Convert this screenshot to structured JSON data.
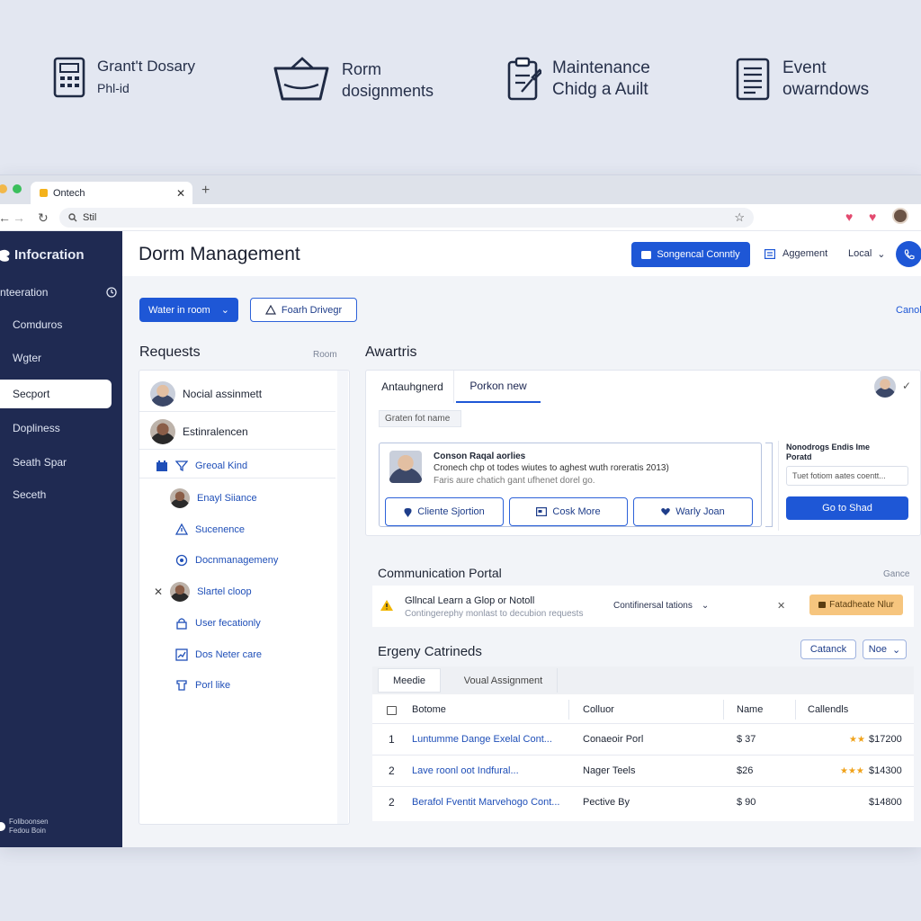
{
  "features": [
    {
      "icon": "calculator-icon",
      "line1": "Grant't Dosary",
      "line2": "Phl-id"
    },
    {
      "icon": "basket-icon",
      "line1": "Rorm",
      "line2": "dosignments"
    },
    {
      "icon": "clipboard-icon",
      "line1": "Maintenance",
      "line2": "Chidg a Auilt"
    },
    {
      "icon": "document-list-icon",
      "line1": "Event",
      "line2": "owarndows"
    }
  ],
  "browser": {
    "tab_title": "Ontech",
    "address": "Stil"
  },
  "sidebar": {
    "brand": "Infocration",
    "items": [
      {
        "label": "nteeration"
      },
      {
        "label": "Comduros"
      },
      {
        "label": "Wgter"
      },
      {
        "label": "Secport"
      },
      {
        "label": "Dopliness"
      },
      {
        "label": "Seath Spar"
      },
      {
        "label": "Seceth"
      }
    ],
    "footer_line1": "Foliboonsen",
    "footer_line2": "Fedou Boin"
  },
  "header": {
    "title": "Dorm Management",
    "primary_button": "Songencal Conntly",
    "agreement_label": "Aggement",
    "locale": "Local"
  },
  "toolbar": {
    "filter_button": "Water in room",
    "search_button": "Foarh Drivegr",
    "cancel_link": "Canol"
  },
  "requests": {
    "title": "Requests",
    "side_label": "Room",
    "items": [
      {
        "label": "Nocial assinmett"
      },
      {
        "label": "Estinralencen"
      },
      {
        "label": "Greoal Kind"
      },
      {
        "label": "Enayl Siiance"
      },
      {
        "label": "Sucenence"
      },
      {
        "label": "Docnmanagemeny"
      },
      {
        "label": "Slartel cloop"
      },
      {
        "label": "User fecationly"
      },
      {
        "label": "Dos Neter care"
      },
      {
        "label": "Porl like"
      }
    ]
  },
  "awards": {
    "title": "Awartris",
    "tabs": [
      "Antauhgnerd",
      "Porkon new"
    ],
    "filter_chip": "Graten fot name",
    "card": {
      "title": "Conson Raqal aorlies",
      "line1": "Cronech chp ot todes wiutes to aghest wuth roreratis 2013)",
      "line2": "Faris aure chatich gant ufhenet dorel go.",
      "buttons": [
        "Cliente Sjortion",
        "Cosk More",
        "Warly Joan"
      ]
    },
    "side_card": {
      "title": "Nonodrogs Endis Ime Poratd",
      "placeholder": "Tuet fotiom aates coentt...",
      "button": "Go to Shad"
    }
  },
  "communication": {
    "title": "Communication Portal",
    "side_label": "Gance",
    "alert_title": "Gllncal Learn a Glop or Notoll",
    "alert_sub": "Contingerephy monlast to decubion requests",
    "dropdown": "Contifinersal tations",
    "badge": "Fatadheate Nlur"
  },
  "energy": {
    "title": "Ergeny Catrineds",
    "button_1": "Catanck",
    "button_2": "Noe",
    "tabs": [
      "Meedie",
      "Voual Assignment"
    ],
    "columns": [
      "Botome",
      "Colluor",
      "Name",
      "Callendls"
    ],
    "rows": [
      {
        "num": "1",
        "title": "Luntumme Dange Exelal Cont...",
        "color": "Conaeoir Porl",
        "name": "$ 37",
        "value": "$17200",
        "stars": "★★"
      },
      {
        "num": "2",
        "title": "Lave roonl oot Indfural...",
        "color": "Nager Teels",
        "name": "$26",
        "value": "$14300",
        "stars": "★★★"
      },
      {
        "num": "2",
        "title": "Berafol Fventit Marvehogo Cont...",
        "color": "Pective By",
        "name": "$ 90",
        "value": "$14800",
        "stars": ""
      }
    ]
  },
  "colors": {
    "sidebar": "#1f2a52",
    "accent": "#1e57d6",
    "badge": "#f6c57e",
    "warning": "#f2b600"
  }
}
